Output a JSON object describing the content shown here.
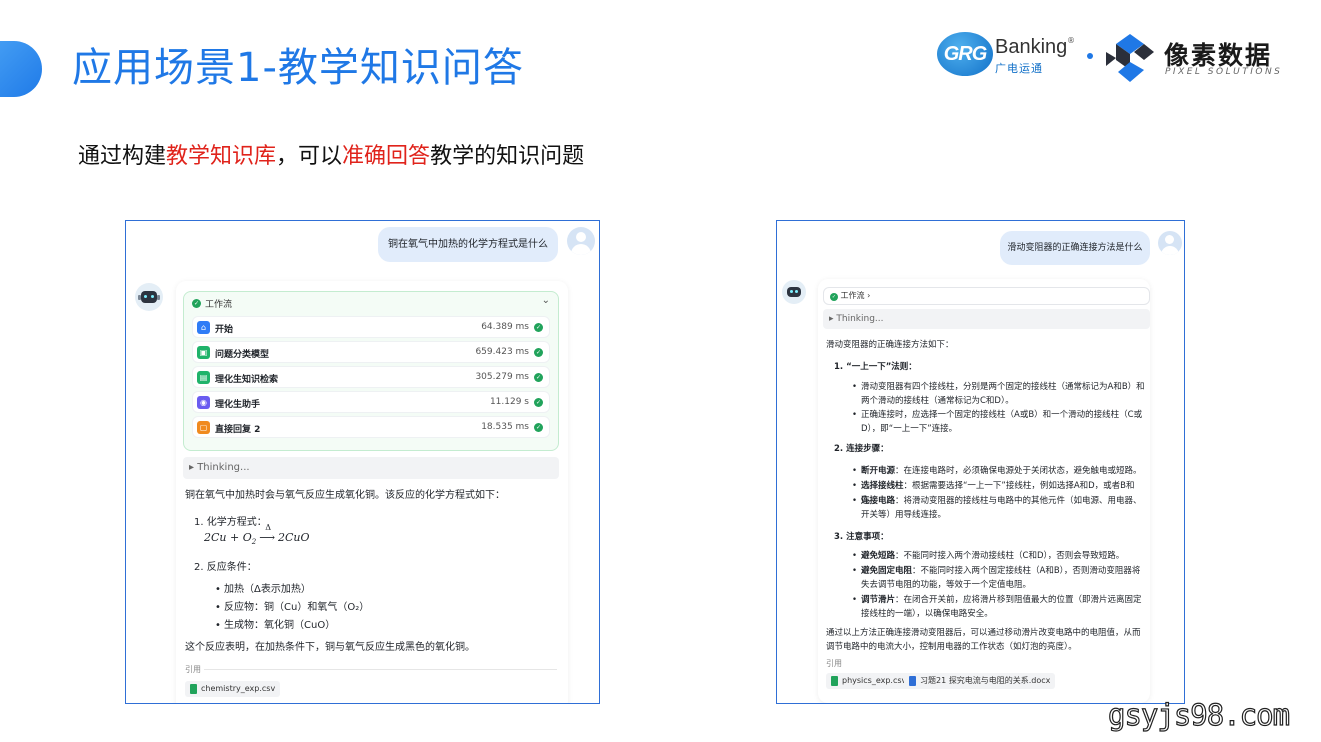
{
  "slide": {
    "title": "应用场景1-教学知识问答",
    "subtitle_parts": [
      "通过构建",
      "教学知识库",
      "，可以",
      "准确回答",
      "教学的知识问题"
    ],
    "accent_color": "#1f78e6",
    "highlight_color": "#e0231b"
  },
  "logos": {
    "grg_mark": "GRG",
    "grg_word": "Banking",
    "grg_reg": "®",
    "grg_cn": "广电运通",
    "separator": "•",
    "pixel_cn": "像素数据",
    "pixel_en": "PIXEL SOLUTIONS"
  },
  "left_chat": {
    "question": "铜在氧气中加热的化学方程式是什么",
    "workflow_label": "工作流",
    "workflow_steps": [
      {
        "name": "开始",
        "time": "64.389 ms",
        "icon": "home-icon",
        "color": "#2f7cf6"
      },
      {
        "name": "问题分类模型",
        "time": "659.423 ms",
        "icon": "model-icon",
        "color": "#1fb36a"
      },
      {
        "name": "理化生知识检索",
        "time": "305.279 ms",
        "icon": "book-icon",
        "color": "#1fb36a"
      },
      {
        "name": "理化生助手",
        "time": "11.129 s",
        "icon": "assistant-icon",
        "color": "#6a5cf0"
      },
      {
        "name": "直接回复 2",
        "time": "18.535 ms",
        "icon": "reply-icon",
        "color": "#f08a1f"
      }
    ],
    "thinking": "Thinking...",
    "intro": "铜在氧气中加热时会与氧气反应生成氧化铜。该反应的化学方程式如下：",
    "item1_title": "1. 化学方程式：",
    "equation_left": "2Cu + O",
    "equation_sub": "2",
    "equation_delta": "Δ",
    "equation_arrow": "⟶",
    "equation_right": "2CuO",
    "item2_title": "2. 反应条件：",
    "conditions": [
      "加热（Δ表示加热）",
      "反应物：铜（Cu）和氧气（O₂）",
      "生成物：氧化铜（CuO）"
    ],
    "conclusion": "这个反应表明，在加热条件下，铜与氧气反应生成黑色的氧化铜。",
    "ref_label": "引用",
    "refs": [
      "chemistry_exp.csv"
    ]
  },
  "right_chat": {
    "question": "滑动变阻器的正确连接方法是什么",
    "workflow_label": "工作流 ›",
    "thinking": "Thinking...",
    "intro": "滑动变阻器的正确连接方法如下：",
    "sec1_title": "1. “一上一下”法则：",
    "sec1_items": [
      "滑动变阻器有四个接线柱，分别是两个固定的接线柱（通常标记为A和B）和两个滑动的接线柱（通常标记为C和D）。",
      "正确连接时，应选择一个固定的接线柱（A或B）和一个滑动的接线柱（C或D），即“一上一下”连接。"
    ],
    "sec2_title": "2. 连接步骤：",
    "sec2_items": [
      {
        "bold": "断开电源",
        "text": "：在连接电路时，必须确保电源处于关闭状态，避免触电或短路。"
      },
      {
        "bold": "选择接线柱",
        "text": "：根据需要选择“一上一下”接线柱，例如选择A和D，或者B和C。"
      },
      {
        "bold": "连接电路",
        "text": "：将滑动变阻器的接线柱与电路中的其他元件（如电源、用电器、开关等）用导线连接。"
      }
    ],
    "sec3_title": "3. 注意事项：",
    "sec3_items": [
      {
        "bold": "避免短路",
        "text": "：不能同时接入两个滑动接线柱（C和D），否则会导致短路。"
      },
      {
        "bold": "避免固定电阻",
        "text": "：不能同时接入两个固定接线柱（A和B），否则滑动变阻器将失去调节电阻的功能，等效于一个定值电阻。"
      },
      {
        "bold": "调节滑片",
        "text": "：在闭合开关前，应将滑片移到阻值最大的位置（即滑片远离固定接线柱的一端），以确保电路安全。"
      }
    ],
    "conclusion": "通过以上方法正确连接滑动变阻器后，可以通过移动滑片改变电路中的电阻值，从而调节电路中的电流大小，控制用电器的工作状态（如灯泡的亮度）。",
    "ref_label": "引用",
    "refs": [
      "physics_exp.csv",
      "习题21 探究电流与电阻的关系.docx"
    ]
  },
  "watermark": "gsyjs98.com"
}
